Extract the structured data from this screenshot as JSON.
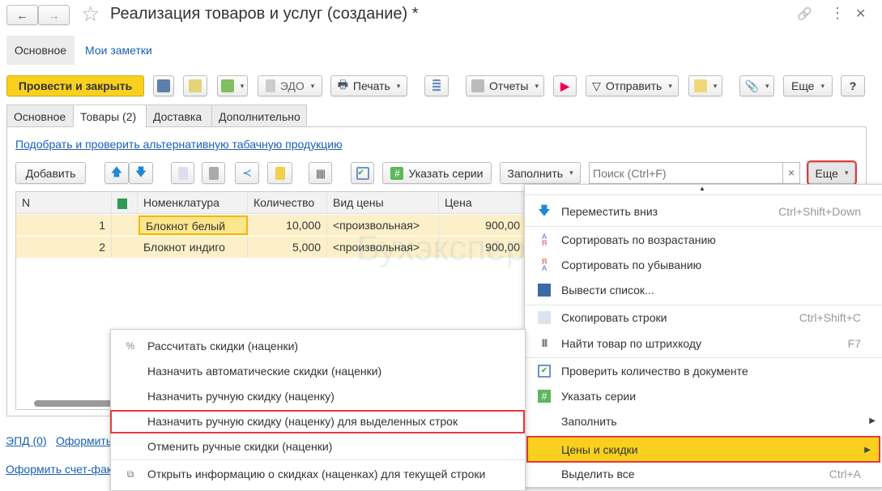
{
  "window": {
    "title": "Реализация товаров и услуг (создание) *",
    "back": "←",
    "forward": "→",
    "star": "☆",
    "link_icon": "🔗",
    "more_icon": "⋮",
    "close_icon": "✕"
  },
  "form_tabs": [
    "Основное",
    "Мои заметки"
  ],
  "toolbar": {
    "post_close": "Провести и закрыть",
    "edo": "ЭДО",
    "print": "Печать",
    "reports": "Отчеты",
    "send": "Отправить",
    "more": "Еще",
    "help": "?"
  },
  "tabs": [
    "Основное",
    "Товары (2)",
    "Доставка",
    "Дополнительно"
  ],
  "tobacco_link": "Подобрать и проверить альтернативную табачную продукцию",
  "table_toolbar": {
    "add": "Добавить",
    "series": "Указать серии",
    "fill": "Заполнить",
    "search_placeholder": "Поиск (Ctrl+F)",
    "clear": "×",
    "more": "Еще"
  },
  "table": {
    "headers": [
      "N",
      "",
      "Номенклатура",
      "Количество",
      "Вид цены",
      "Цена"
    ],
    "rows": [
      [
        "1",
        "",
        "Блокнот белый",
        "10,000",
        "<произвольная>",
        "900,00"
      ],
      [
        "2",
        "",
        "Блокнот индиго",
        "5,000",
        "<произвольная>",
        "900,00"
      ]
    ]
  },
  "watermark": "Бухэксперт",
  "bottom": {
    "epd": "ЭПД (0)",
    "issue": "Оформить",
    "invoice": "Оформить счет-фак"
  },
  "more_menu": [
    {
      "label": "Переместить вниз",
      "shortcut": "Ctrl+Shift+Down",
      "icon": "arrow-down"
    },
    {
      "label": "Сортировать по возрастанию",
      "shortcut": "",
      "icon": "sort-asc"
    },
    {
      "label": "Сортировать по убыванию",
      "shortcut": "",
      "icon": "sort-desc"
    },
    {
      "label": "Вывести список...",
      "shortcut": "",
      "icon": "list-output"
    },
    {
      "label": "Скопировать строки",
      "shortcut": "Ctrl+Shift+C",
      "icon": "copy"
    },
    {
      "label": "Найти товар по штрихкоду",
      "shortcut": "F7",
      "icon": "barcode"
    },
    {
      "label": "Проверить количество в документе",
      "shortcut": "",
      "icon": "check"
    },
    {
      "label": "Указать серии",
      "shortcut": "",
      "icon": "hash"
    },
    {
      "label": "Заполнить",
      "shortcut": "",
      "icon": ""
    },
    {
      "label": "Цены и скидки",
      "shortcut": "",
      "icon": ""
    },
    {
      "label": "Выделить все",
      "shortcut": "Ctrl+A",
      "icon": ""
    }
  ],
  "discount_menu": [
    {
      "label": "Рассчитать скидки (наценки)",
      "icon": "percent"
    },
    {
      "label": "Назначить автоматические скидки (наценки)",
      "icon": ""
    },
    {
      "label": "Назначить ручную скидку (наценку)",
      "icon": ""
    },
    {
      "label": "Назначить ручную скидку (наценку) для выделенных строк",
      "icon": ""
    },
    {
      "label": "Отменить ручные скидки (наценки)",
      "icon": ""
    },
    {
      "label": "Открыть информацию о скидках (наценках) для текущей строки",
      "icon": "open-window"
    }
  ],
  "colors": {
    "accent_yellow": "#f9d01e",
    "highlight_red": "#e8383d",
    "row_bg": "#fdf4d4",
    "link": "#1a5fb4"
  }
}
